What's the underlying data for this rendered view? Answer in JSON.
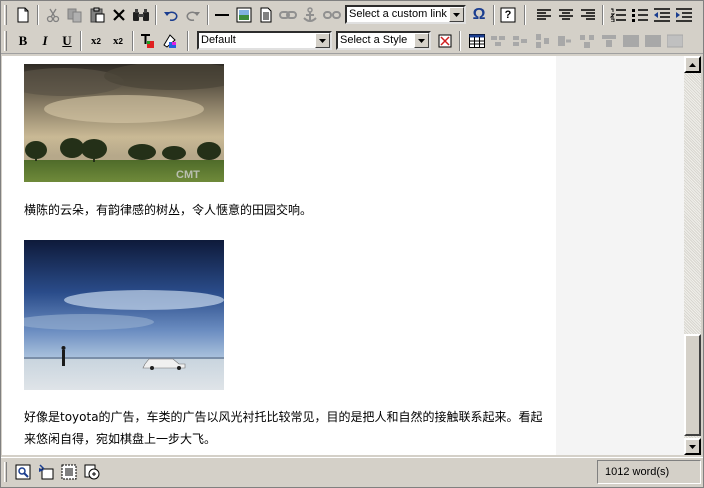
{
  "toolbar1": {
    "buttons": [
      "new-document-icon",
      "cut-icon",
      "copy-icon",
      "paste-icon",
      "delete-icon",
      "find-icon",
      "undo-icon",
      "redo-icon",
      "horizontal-rule-icon",
      "insert-image-icon",
      "insert-document-icon",
      "link-icon",
      "anchor-icon",
      "unlink-icon"
    ],
    "custom_link_select": "Select a custom link",
    "special_char_glyph": "Ω",
    "help_glyph": "?",
    "align_buttons": [
      "align-left-icon",
      "align-center-icon",
      "align-right-icon",
      "ordered-list-icon",
      "unordered-list-icon",
      "outdent-icon",
      "indent-icon"
    ]
  },
  "toolbar2": {
    "bold": "B",
    "italic": "I",
    "underline": "U",
    "superscript": "x",
    "subscript": "x",
    "superscript_mark": "2",
    "subscript_mark": "2",
    "font_select": "Default",
    "style_select": "Select a Style",
    "table_buttons": [
      "insert-table-icon",
      "insert-row-icon",
      "delete-row-icon",
      "insert-column-icon",
      "delete-column-icon",
      "merge-cells-icon",
      "split-cell-icon",
      "table-properties-icon",
      "cell-properties-icon",
      "row-properties-icon"
    ]
  },
  "content": {
    "photo1_caption": "CMT",
    "paragraph1": "横陈的云朵，有韵律感的树丛，令人惬意的田园交响。",
    "paragraph2": "好像是toyota的广告，车类的广告以风光衬托比较常见，目的是把人和自然的接触联系起来。看起来悠闲自得，宛如棋盘上一步大飞。"
  },
  "statusbar": {
    "word_count": "1012 word(s)",
    "mode_buttons": [
      "design-mode-icon",
      "html-mode-icon",
      "preview-mode-icon",
      "source-view-icon"
    ]
  },
  "colors": {
    "chrome": "#d4d0c8",
    "editor_bg": "#ffffff",
    "side_pane": "#f4f4f4"
  }
}
